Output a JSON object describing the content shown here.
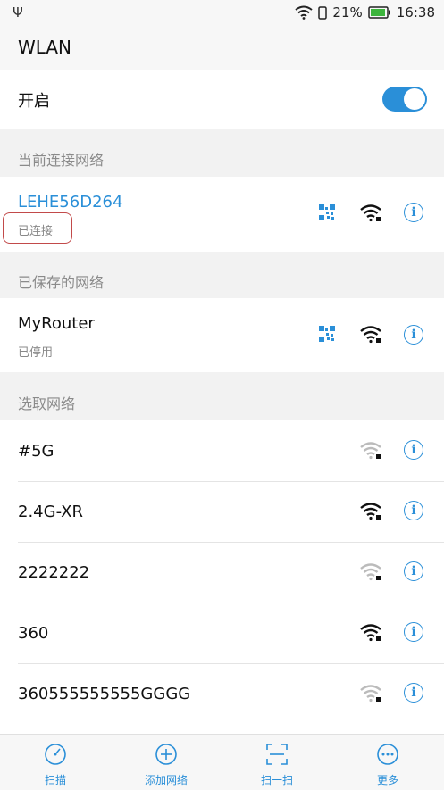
{
  "status_bar": {
    "battery_percent": "21%",
    "time": "16:38",
    "usb_symbol": "Ψ"
  },
  "header": {
    "title": "WLAN"
  },
  "wlan_toggle": {
    "label": "开启",
    "enabled": true
  },
  "sections": {
    "current": "当前连接网络",
    "saved": "已保存的网络",
    "available": "选取网络"
  },
  "current_network": {
    "name": "LEHE56D264",
    "status": "已连接"
  },
  "saved_network": {
    "name": "MyRouter",
    "status": "已停用"
  },
  "available_networks": [
    {
      "name": "#5G",
      "signal": "weak"
    },
    {
      "name": "2.4G-XR",
      "signal": "strong"
    },
    {
      "name": "2222222",
      "signal": "weak"
    },
    {
      "name": "360",
      "signal": "strong"
    },
    {
      "name": "360555555555GGGG",
      "signal": "weak"
    }
  ],
  "bottom_tabs": [
    {
      "label": "扫描",
      "icon": "scan-icon"
    },
    {
      "label": "添加网络",
      "icon": "add-network-icon"
    },
    {
      "label": "扫一扫",
      "icon": "qr-scan-icon"
    },
    {
      "label": "更多",
      "icon": "more-icon"
    }
  ],
  "colors": {
    "accent": "#2a8fd8",
    "highlight_box": "#c24a4a",
    "section_bg": "#f2f2f2"
  }
}
